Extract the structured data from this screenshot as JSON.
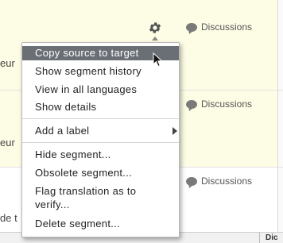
{
  "rows": [
    {
      "fragment": "eur",
      "discussions_label": "Discussions"
    },
    {
      "fragment": "eur",
      "discussions_label": "Discussions"
    },
    {
      "fragment": "de t",
      "discussions_label": "Discussions"
    }
  ],
  "context_menu": {
    "items": [
      {
        "label": "Copy source to target",
        "highlighted": true
      },
      {
        "label": "Show segment history"
      },
      {
        "label": "View in all languages"
      },
      {
        "label": "Show details"
      },
      {
        "label": "Add a label",
        "has_submenu": true
      },
      {
        "label": "Hide segment..."
      },
      {
        "label": "Obsolete segment..."
      },
      {
        "label": "Flag translation as to verify..."
      },
      {
        "label": "Delete segment..."
      }
    ],
    "flag_line1": "Flag translation as to",
    "flag_line2": "verify..."
  },
  "bottom_bar": {
    "column_label": "Dic"
  },
  "icons": {
    "settings": "gear-icon",
    "discussion": "speech-bubble-icon",
    "submenu": "triangle-right-icon",
    "cursor": "mouse-pointer-icon"
  },
  "colors": {
    "row_background": "#fdfde6",
    "menu_highlight": "#6a6f76"
  }
}
